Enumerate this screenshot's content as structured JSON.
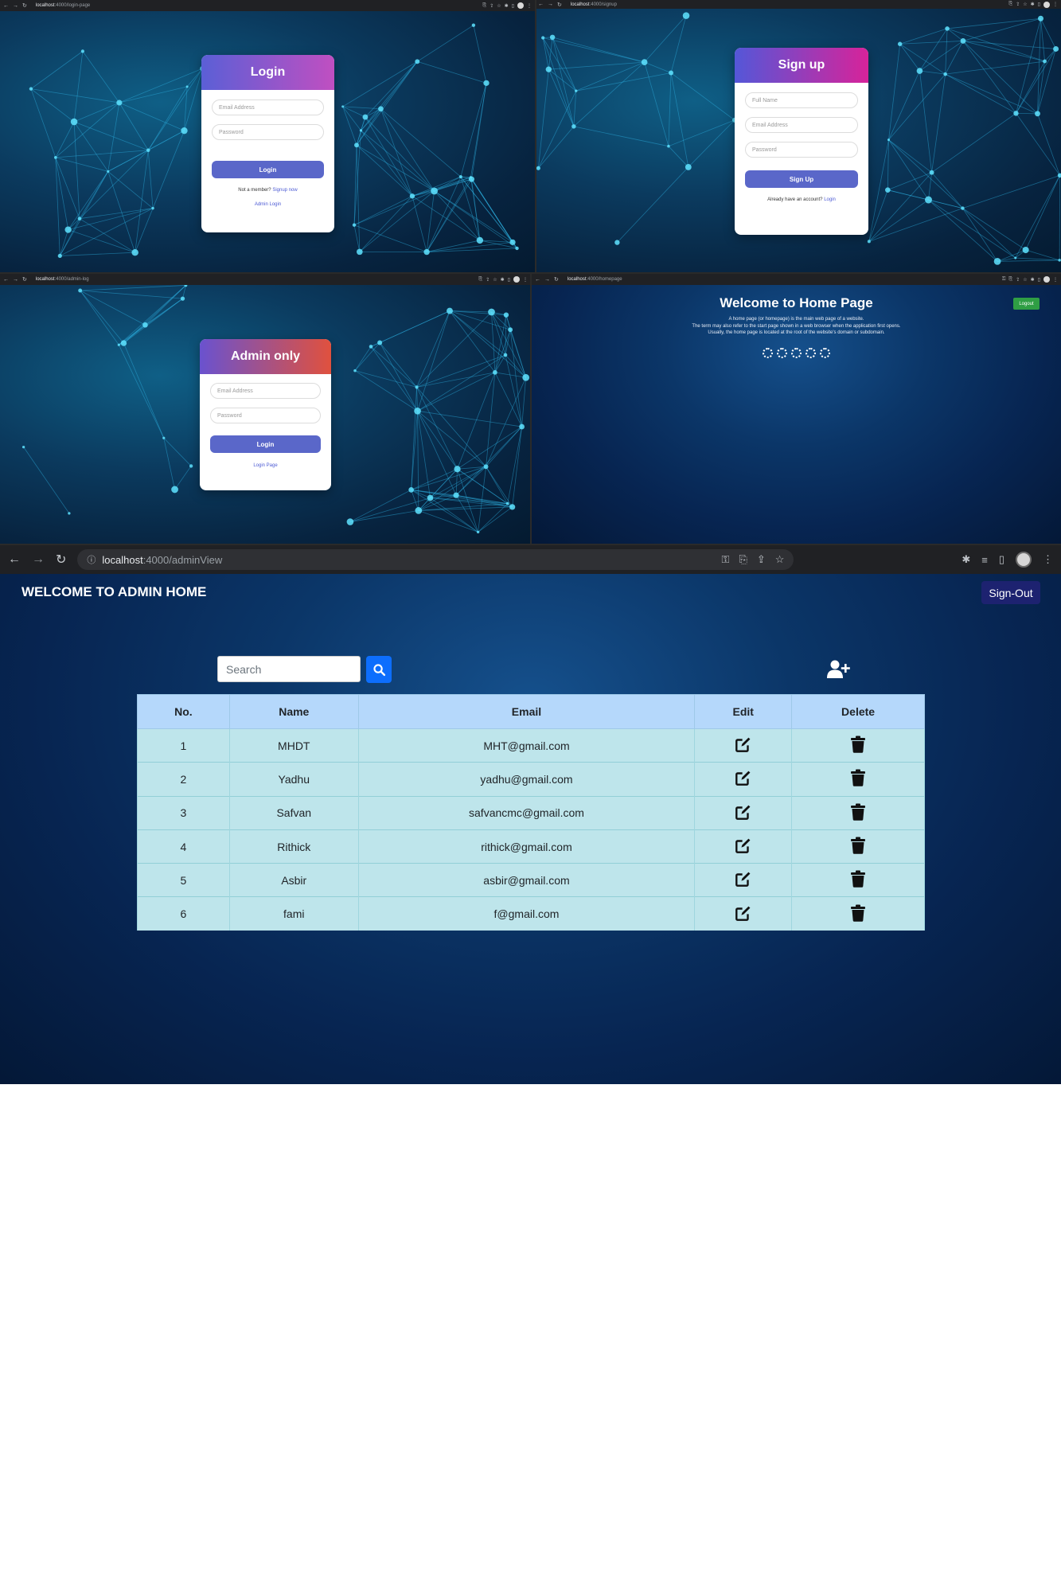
{
  "login_screen": {
    "url_host": "localhost",
    "url_path": ":4000/login-page",
    "card_title": "Login",
    "email_placeholder": "Email Address",
    "password_placeholder": "Password",
    "login_button": "Login",
    "member_text": "Not a member?",
    "signup_link": "Signup now",
    "admin_link": "Admin Login",
    "header_gradient": [
      "#5b5fd6",
      "#c04fc1"
    ]
  },
  "signup_screen": {
    "url_host": "localhost",
    "url_path": ":4000/signup",
    "card_title": "Sign up",
    "name_placeholder": "Full Name",
    "email_placeholder": "Email Address",
    "password_placeholder": "Password",
    "signup_button": "Sign Up",
    "account_text": "Already have an account?",
    "login_link": "Login",
    "header_gradient": [
      "#5457d8",
      "#d7239a"
    ]
  },
  "admin_login_screen": {
    "url_host": "localhost",
    "url_path": ":4000/admin-log",
    "card_title": "Admin only",
    "email_placeholder": "Email Address",
    "password_placeholder": "Password",
    "login_button": "Login",
    "login_page_link": "Login Page",
    "header_gradient": [
      "#6a52cf",
      "#e0513e"
    ]
  },
  "home_screen": {
    "url_host": "localhost",
    "url_path": ":4000/homepage",
    "title": "Welcome to Home Page",
    "line1": "A home page (or homepage) is the main web page of a website.",
    "line2": "The term may also refer to the start page shown in a web browser when the application first opens.",
    "line3": "Usually, the home page is located at the root of the website's domain or subdomain.",
    "logout_button": "Logout"
  },
  "admin_view": {
    "url_host": "localhost",
    "url_path": ":4000/adminView",
    "title": "WELCOME TO ADMIN HOME",
    "signout_button": "Sign-Out",
    "search_placeholder": "Search",
    "columns": [
      "No.",
      "Name",
      "Email",
      "Edit",
      "Delete"
    ],
    "rows": [
      {
        "no": "1",
        "name": "MHDT",
        "email": "MHT@gmail.com"
      },
      {
        "no": "2",
        "name": "Yadhu",
        "email": "yadhu@gmail.com"
      },
      {
        "no": "3",
        "name": "Safvan",
        "email": "safvancmc@gmail.com"
      },
      {
        "no": "4",
        "name": "Rithick",
        "email": "rithick@gmail.com"
      },
      {
        "no": "5",
        "name": "Asbir",
        "email": "asbir@gmail.com"
      },
      {
        "no": "6",
        "name": "fami",
        "email": "f@gmail.com"
      }
    ],
    "icons": {
      "search": "search-icon",
      "add_user": "user-plus-icon",
      "edit": "edit-icon",
      "delete": "trash-icon"
    },
    "colors": {
      "header_row": "#b5d8fb",
      "body_row": "#bee5eb",
      "search_button": "#0d6efd",
      "signout": "#1d2270"
    }
  }
}
